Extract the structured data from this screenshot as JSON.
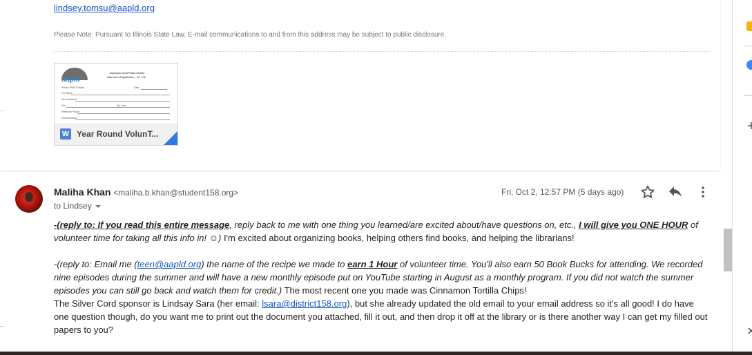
{
  "prev_message": {
    "signature_email": "lindsey.tomsu@aapld.org",
    "notice": "Please Note: Pursuant to Illinois State Law, E-mail communications to and from this address may be subject to public disclosure.",
    "attachment": {
      "name": "Year Round VolunT...",
      "icon_letter": "W",
      "thumb_logo": "aapld",
      "thumb_header1": "Algonquin Area Public Library",
      "thumb_header2": "VolunTeen Registration -- Gr. 7-12",
      "thumb_subtitle": "Please PRINT Neatly",
      "thumb_fields": [
        "Full Name",
        "Street Address",
        "City",
        "Zip Code",
        "Preferred Phone",
        "Email Address"
      ],
      "thumb_date_label": "Date"
    }
  },
  "message": {
    "sender_name": "Maliha Khan",
    "sender_email": "<maliha.b.khan@student158.org>",
    "to": "to Lindsey",
    "date": "Fri, Oct 2, 12:57 PM (5 days ago)",
    "p1": {
      "a": "-(reply to: If you read this entire message",
      "b": ", reply back to me with one thing you learned/are excited about/have questions on, etc., ",
      "c": "I will give you ONE HOUR",
      "d": " of volunteer time for taking all this info in! ☺)",
      "e": " I'm excited about organizing books, helping others find books, and helping the librarians!"
    },
    "p2": {
      "a": "-(reply to: Email me (",
      "link": "teen@aapld.org",
      "b": ") the name of the recipe we made to ",
      "c": "earn 1 Hour",
      "d": " of volunteer time. You'll also earn 50 Book Bucks for attending. We recorded nine episodes during the summer and will have a new monthly episode put on YouTube starting in August as a monthly program. If you did not watch the summer episodes you can still go back and watch them for credit.)",
      "e": "  The most recent one you made was Cinnamon Tortilla Chips!"
    },
    "p3": {
      "a": "The Silver Cord sponsor is Lindsay Sara (her email: ",
      "link": "lsara@district158.org",
      "b": "), but she already updated the old email to your email address so it's all good! I do have one question though, do you want me to print out the document you attached, fill it out, and then drop it off at the library or is there another way I can get my filled out papers to you?"
    }
  },
  "icons": [
    "star-icon",
    "reply-icon",
    "more-vert-icon",
    "calendar-icon",
    "contacts-icon",
    "add-icon",
    "close-icon"
  ],
  "colors": {
    "link": "#1155cc",
    "attachment_accent": "#2a7ae2",
    "word_blue": "#4a7fd4"
  }
}
